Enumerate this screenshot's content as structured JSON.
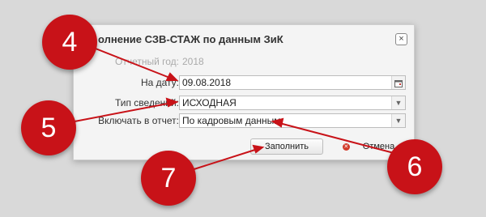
{
  "dialog": {
    "title": "олнение СЗВ-СТАЖ по данным ЗиК",
    "close_icon": "×",
    "fields": [
      {
        "label": "Отчетный год:",
        "value": "2018"
      },
      {
        "label": "На дату:",
        "value": "09.08.2018"
      },
      {
        "label": "Тип сведений:",
        "value": "ИСХОДНАЯ"
      },
      {
        "label": "Включать в отчет:",
        "value": "По кадровым данным"
      }
    ],
    "buttons": {
      "fill": "Заполнить",
      "cancel": "Отмена"
    }
  },
  "callouts": [
    "4",
    "5",
    "6",
    "7"
  ],
  "colors": {
    "callout": "#c81218",
    "arrow": "#c81218"
  }
}
